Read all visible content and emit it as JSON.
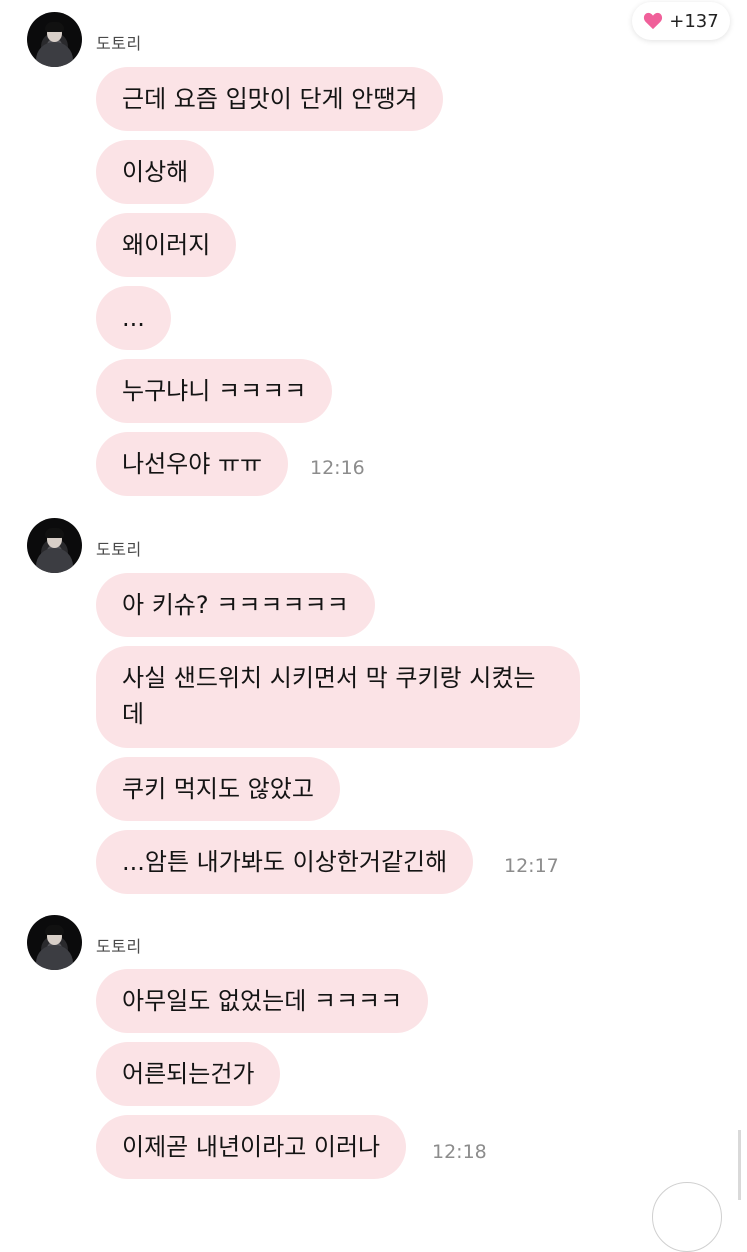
{
  "likes": {
    "count": "+137",
    "icon": "heart-icon",
    "color": "#f0609a"
  },
  "bubble_color": "#fbe3e6",
  "groups": [
    {
      "sender": "도토리",
      "messages": [
        "근데 요즘 입맛이 단게 안땡겨",
        "이상해",
        "왜이러지",
        "...",
        "누구냐니 ㅋㅋㅋㅋ",
        "나선우야 ㅠㅠ"
      ],
      "time": "12:16"
    },
    {
      "sender": "도토리",
      "messages": [
        "아 키슈? ㅋㅋㅋㅋㅋㅋ",
        "사실 샌드위치 시키면서 막 쿠키랑 시켰는데",
        "쿠키 먹지도 않았고",
        "...암튼 내가봐도 이상한거같긴해"
      ],
      "time": "12:17"
    },
    {
      "sender": "도토리",
      "messages": [
        "아무일도 없었는데 ㅋㅋㅋㅋ",
        "어른되는건가",
        "이제곧 내년이라고 이러나"
      ],
      "time": "12:18"
    }
  ]
}
